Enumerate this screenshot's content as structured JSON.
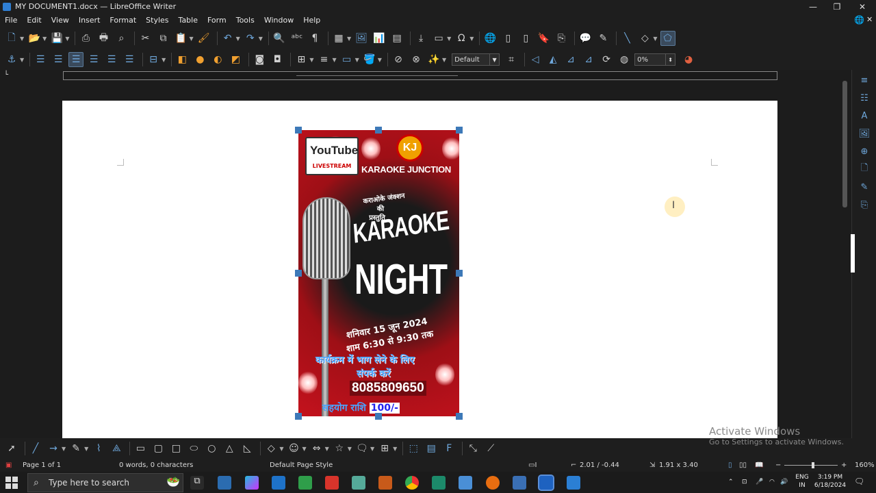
{
  "window": {
    "title": "MY DOCUMENT1.docx — LibreOffice Writer"
  },
  "window_controls": {
    "minimize": "—",
    "restore": "❐",
    "close": "✕"
  },
  "menu": [
    "File",
    "Edit",
    "View",
    "Insert",
    "Format",
    "Styles",
    "Table",
    "Form",
    "Tools",
    "Window",
    "Help"
  ],
  "toolbar2": {
    "style_combo": "Default",
    "transparency": "0%"
  },
  "poster": {
    "yt_logo": "YouTube",
    "yt_live": "LIVESTREAM",
    "kj_logo": "KJ",
    "brand": "KARAOKE JUNCTION",
    "line1": "कराओके जंक्शन",
    "line2": "की",
    "line3": "प्रस्तुति",
    "title1": "KARAOKE",
    "title2": "NIGHT",
    "date": "शनिवार 15 जून 2024",
    "time": "शाम 6:30 से 9:30 तक",
    "cta1": "कार्यक्रम में भाग लेने के लिए",
    "cta2": "संपर्क करें",
    "phone": "8085809650",
    "fee_label": "सहयोग राशि",
    "fee_value": "100/-"
  },
  "watermark": {
    "line1": "Activate Windows",
    "line2": "Go to Settings to activate Windows."
  },
  "status": {
    "page": "Page 1 of 1",
    "words": "0 words, 0 characters",
    "page_style": "Default Page Style",
    "position": "2.01 / -0.44",
    "size": "1.91 x 3.40",
    "zoom": "160%"
  },
  "taskbar": {
    "search_placeholder": "Type here to search",
    "lang1": "ENG",
    "lang2": "IN",
    "time": "3:19 PM",
    "date": "6/18/2024"
  },
  "colors": {
    "accent": "#3d79b8",
    "poster_red": "#c4121d",
    "background": "#1c1c1c"
  }
}
